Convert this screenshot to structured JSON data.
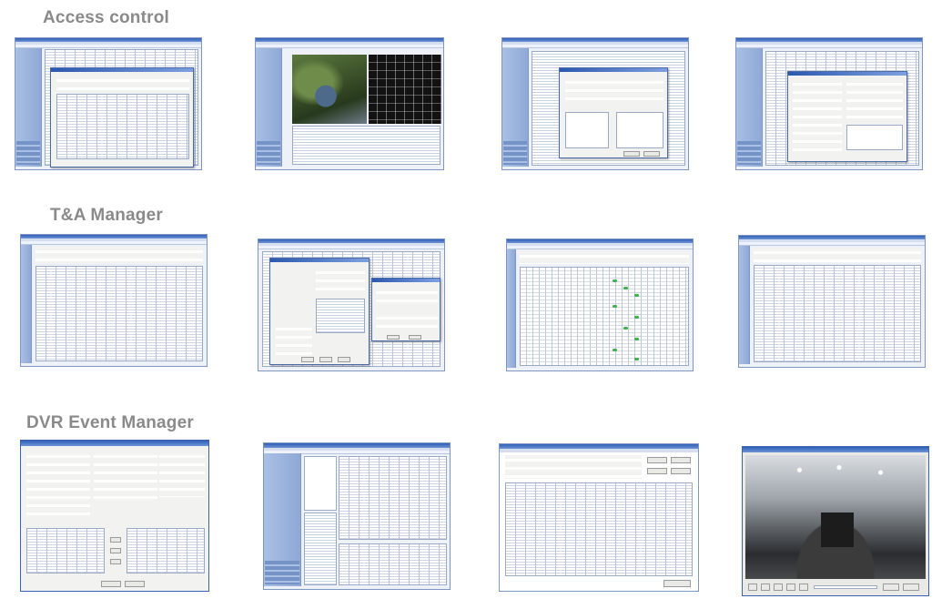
{
  "sections": [
    {
      "title": "Access control"
    },
    {
      "title": "T&A Manager"
    },
    {
      "title": "DVR Event Manager"
    }
  ],
  "colors": {
    "title_text": "#8a8a8a",
    "window_chrome": "#2f5fb6",
    "sidebar": "#a9c0e4",
    "attendance_marker": "#3bb24a"
  },
  "thumbnails": {
    "access_control": [
      "access-control-event-list",
      "access-control-map-view",
      "access-control-settings-dialog",
      "access-control-user-dialog"
    ],
    "ta_manager": [
      "ta-manager-records-table",
      "ta-manager-settings-dialogs",
      "ta-manager-attendance-grid",
      "ta-manager-report-table"
    ],
    "dvr_event_manager": [
      "dvr-event-config-window",
      "dvr-event-list-window",
      "dvr-event-search-window",
      "dvr-video-playback-window"
    ]
  }
}
